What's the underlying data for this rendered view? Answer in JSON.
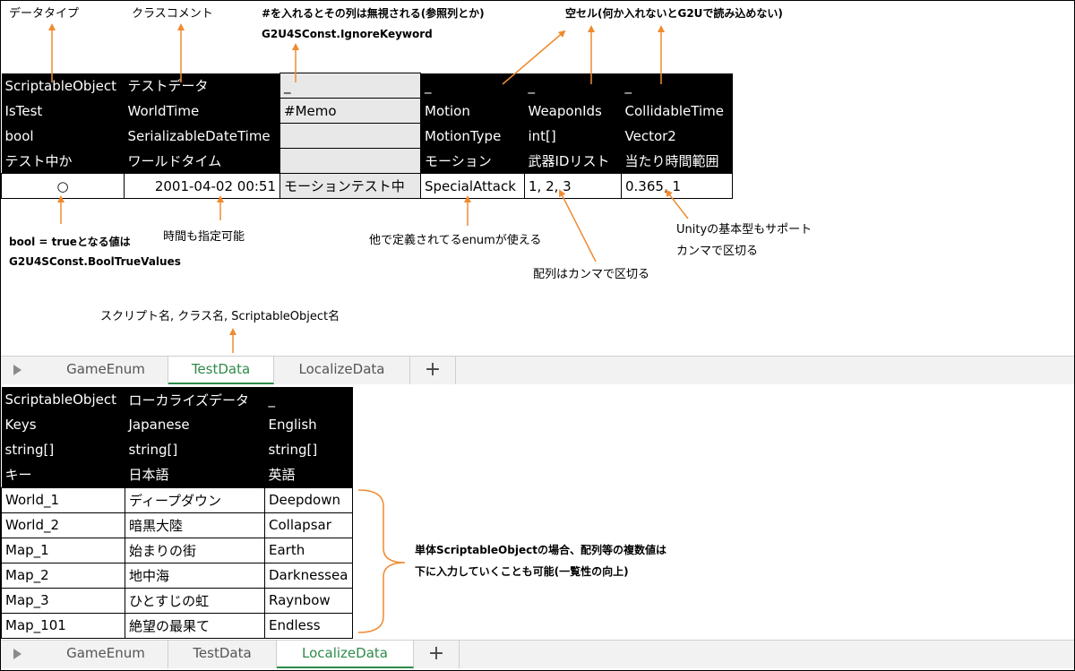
{
  "annotations": {
    "data_type": "データタイプ",
    "class_comment": "クラスコメント",
    "ignore_col_line1": "#を入れるとその列は無視される(参照列とか)",
    "ignore_col_line2": "G2U4SConst.IgnoreKeyword",
    "empty_cell": "空セル(何か入れないとG2Uで読み込めない)",
    "bool_true_line1": "bool = trueとなる値は",
    "bool_true_line2": "G2U4SConst.BoolTrueValues",
    "time_spec": "時間も指定可能",
    "enum_usable": "他で定義されてるenumが使える",
    "array_comma": "配列はカンマで区切る",
    "unity_types_line1": "Unityの基本型もサポート",
    "unity_types_line2": "カンマで区切る",
    "script_name": "スクリプト名, クラス名, ScriptableObject名",
    "single_so_line1": "単体ScriptableObjectの場合、配列等の複数値は",
    "single_so_line2": "下に入力していくことも可能(一覧性の向上)"
  },
  "sheet1": {
    "header_rows": [
      [
        "ScriptableObject",
        "テストデータ",
        "_",
        "_",
        "_",
        "_"
      ],
      [
        "IsTest",
        "WorldTime",
        "#Memo",
        "Motion",
        "WeaponIds",
        "CollidableTime"
      ],
      [
        "bool",
        "SerializableDateTime",
        "",
        "MotionType",
        "int[]",
        "Vector2"
      ],
      [
        "テスト中か",
        "ワールドタイム",
        "",
        "モーション",
        "武器IDリスト",
        "当たり時間範囲"
      ]
    ],
    "data_row": [
      "○",
      "2001-04-02 00:51",
      "モーションテスト中",
      "SpecialAttack",
      "1, 2, 3",
      "0.365, 1"
    ]
  },
  "tabs1": {
    "items": [
      "GameEnum",
      "TestData",
      "LocalizeData"
    ],
    "active": "TestData",
    "add": "+"
  },
  "sheet2": {
    "header_rows": [
      [
        "ScriptableObject",
        "ローカライズデータ",
        "_"
      ],
      [
        "Keys",
        "Japanese",
        "English"
      ],
      [
        "string[]",
        "string[]",
        "string[]"
      ],
      [
        "キー",
        "日本語",
        "英語"
      ]
    ],
    "data_rows": [
      [
        "World_1",
        "ディープダウン",
        "Deepdown"
      ],
      [
        "World_2",
        "暗黒大陸",
        "Collapsar"
      ],
      [
        "Map_1",
        "始まりの街",
        "Earth"
      ],
      [
        "Map_2",
        "地中海",
        "Darknessea"
      ],
      [
        "Map_3",
        "ひとすじの虹",
        "Raynbow"
      ],
      [
        "Map_101",
        "絶望の最果て",
        "Endless"
      ]
    ]
  },
  "tabs2": {
    "items": [
      "GameEnum",
      "TestData",
      "LocalizeData"
    ],
    "active": "LocalizeData",
    "add": "+"
  },
  "colors": {
    "arrow": "#f08a30",
    "active_tab": "#2f8a4a",
    "header_bg": "#000000",
    "memo_bg": "#e8e8e8"
  }
}
